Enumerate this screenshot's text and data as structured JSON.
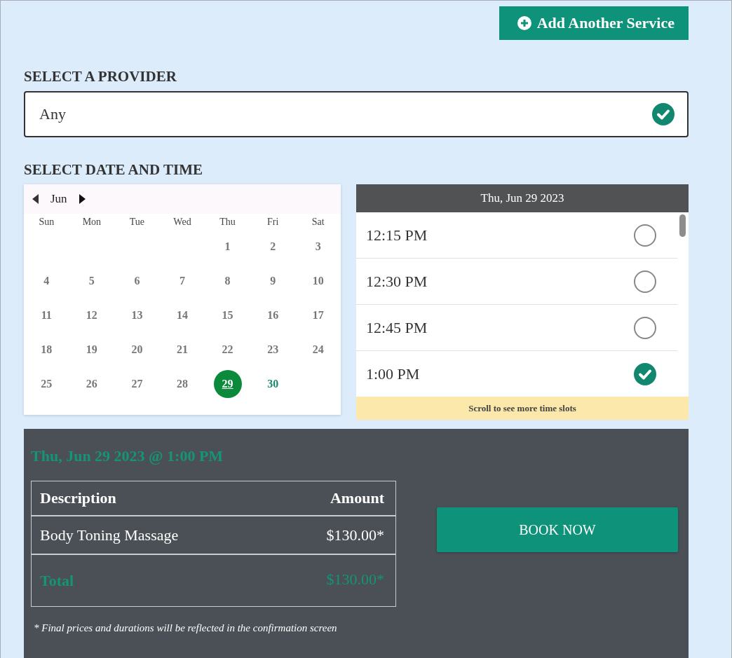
{
  "add_service_button": {
    "label": "Add Another Service"
  },
  "provider": {
    "heading": "SELECT A PROVIDER",
    "value": "Any",
    "confirmed": true
  },
  "date_time": {
    "heading": "SELECT DATE AND TIME"
  },
  "calendar": {
    "month": "Jun",
    "weekdays": [
      "Sun",
      "Mon",
      "Tue",
      "Wed",
      "Thu",
      "Fri",
      "Sat"
    ],
    "weeks": [
      [
        {
          "day": "1",
          "available": false,
          "selected": false
        },
        {
          "day": "2",
          "available": false,
          "selected": false
        },
        {
          "day": "3",
          "available": false,
          "selected": false
        }
      ],
      [
        {
          "day": "4",
          "available": false,
          "selected": false
        },
        {
          "day": "5",
          "available": false,
          "selected": false
        },
        {
          "day": "6",
          "available": false,
          "selected": false
        },
        {
          "day": "7",
          "available": false,
          "selected": false
        },
        {
          "day": "8",
          "available": false,
          "selected": false
        },
        {
          "day": "9",
          "available": false,
          "selected": false
        },
        {
          "day": "10",
          "available": false,
          "selected": false
        }
      ],
      [
        {
          "day": "11",
          "available": false,
          "selected": false
        },
        {
          "day": "12",
          "available": false,
          "selected": false
        },
        {
          "day": "13",
          "available": false,
          "selected": false
        },
        {
          "day": "14",
          "available": false,
          "selected": false
        },
        {
          "day": "15",
          "available": false,
          "selected": false
        },
        {
          "day": "16",
          "available": false,
          "selected": false
        },
        {
          "day": "17",
          "available": false,
          "selected": false
        }
      ],
      [
        {
          "day": "18",
          "available": false,
          "selected": false
        },
        {
          "day": "19",
          "available": false,
          "selected": false
        },
        {
          "day": "20",
          "available": false,
          "selected": false
        },
        {
          "day": "21",
          "available": false,
          "selected": false
        },
        {
          "day": "22",
          "available": false,
          "selected": false
        },
        {
          "day": "23",
          "available": false,
          "selected": false
        },
        {
          "day": "24",
          "available": false,
          "selected": false
        }
      ],
      [
        {
          "day": "25",
          "available": false,
          "selected": false
        },
        {
          "day": "26",
          "available": false,
          "selected": false
        },
        {
          "day": "27",
          "available": false,
          "selected": false
        },
        {
          "day": "28",
          "available": false,
          "selected": false
        },
        {
          "day": "29",
          "available": true,
          "selected": true
        },
        {
          "day": "30",
          "available": true,
          "selected": false
        }
      ]
    ]
  },
  "time_slots": {
    "date": "Thu, Jun 29 2023",
    "slots": [
      {
        "time": "12:15 PM",
        "selected": false
      },
      {
        "time": "12:30 PM",
        "selected": false
      },
      {
        "time": "12:45 PM",
        "selected": false
      },
      {
        "time": "1:00 PM",
        "selected": true
      }
    ],
    "hint": "Scroll to see more time slots"
  },
  "summary": {
    "title": "Thu, Jun 29 2023 @ 1:00 PM",
    "columns": [
      "Description",
      "Amount"
    ],
    "rows": [
      {
        "description": "Body Toning Massage",
        "amount": "$130.00*"
      }
    ],
    "total": {
      "label": "Total",
      "amount": "$130.00*"
    },
    "footnote": "* Final prices and durations will be reflected in the confirmation screen",
    "book_button": {
      "label": "BOOK NOW"
    }
  }
}
